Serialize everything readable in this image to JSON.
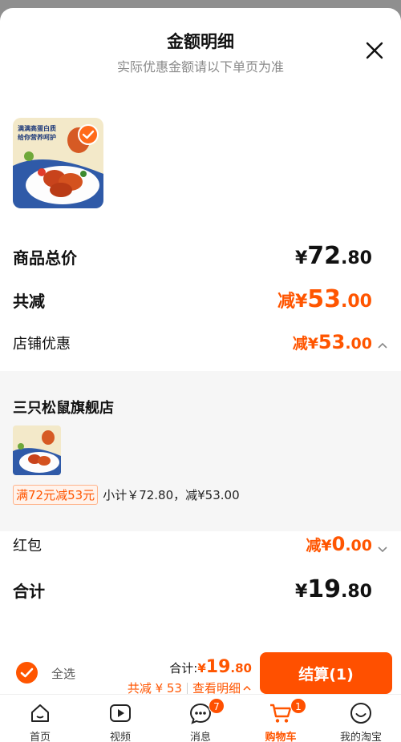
{
  "modal": {
    "title": "金额明细",
    "subtitle": "实际优惠金额请以下单页为准"
  },
  "product_image": {
    "caption_line1": "满满高蛋白质",
    "caption_line2": "给你营养呵护"
  },
  "summary": {
    "total_label": "商品总价",
    "total_sym": "¥",
    "total_int": "72",
    "total_dec": ".80",
    "reduce_label": "共减",
    "reduce_prefix": "减¥",
    "reduce_int": "53",
    "reduce_dec": ".00",
    "store_discount_label": "店铺优惠",
    "store_discount_prefix": "减¥",
    "store_discount_int": "53",
    "store_discount_dec": ".00"
  },
  "store": {
    "name": "三只松鼠旗舰店",
    "promo_tag": "满72元减53元",
    "promo_subtotal": "小计￥72.80，减¥53.00"
  },
  "red_packet": {
    "label": "红包",
    "prefix": "减¥",
    "int": "0",
    "dec": ".00"
  },
  "grand_total": {
    "label": "合计",
    "sym": "¥",
    "int": "19",
    "dec": ".80"
  },
  "bottom_bar": {
    "select_all": "全选",
    "total_prefix": "合计:",
    "total_sym": "¥",
    "total_int": "19",
    "total_dec": ".80",
    "reduce_text": "共减 ¥ 53",
    "details_link": "查看明细",
    "checkout_label": "结算(1)"
  },
  "tabs": [
    {
      "label": "首页",
      "icon": "home-icon"
    },
    {
      "label": "视频",
      "icon": "video-icon"
    },
    {
      "label": "消息",
      "icon": "message-icon",
      "badge": "7"
    },
    {
      "label": "购物车",
      "icon": "cart-icon",
      "badge": "1",
      "active": true
    },
    {
      "label": "我的淘宝",
      "icon": "profile-icon"
    }
  ],
  "colors": {
    "accent": "#ff5500",
    "checkout": "#ff5000"
  }
}
